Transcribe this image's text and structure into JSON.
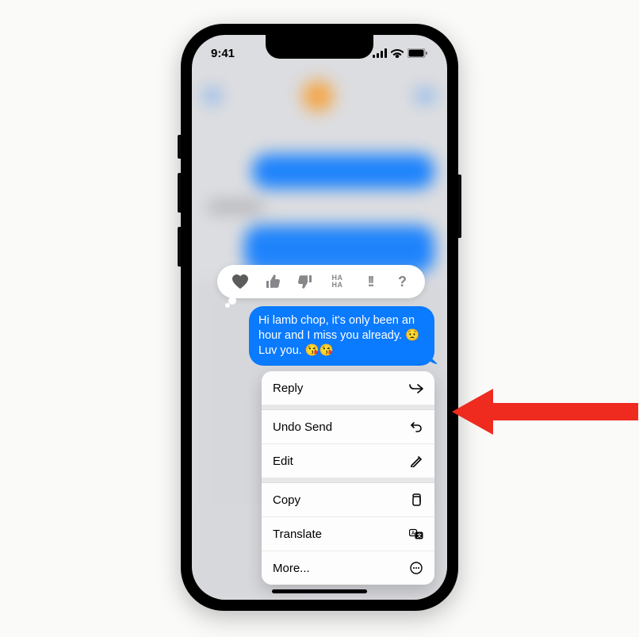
{
  "status": {
    "time": "9:41"
  },
  "message": {
    "text": "Hi lamb chop, it's only been an hour and I miss you already. 😟 Luv you. 😘😘"
  },
  "tapbacks": {
    "heart": "heart",
    "thumbs_up": "thumbs-up",
    "thumbs_down": "thumbs-down",
    "haha": "HA\nHA",
    "exclaim": "!!",
    "question": "?"
  },
  "context_menu": {
    "groups": [
      [
        {
          "label": "Reply",
          "icon": "reply-arrow-icon"
        }
      ],
      [
        {
          "label": "Undo Send",
          "icon": "undo-icon"
        },
        {
          "label": "Edit",
          "icon": "pencil-icon"
        }
      ],
      [
        {
          "label": "Copy",
          "icon": "copy-icon"
        },
        {
          "label": "Translate",
          "icon": "translate-icon"
        },
        {
          "label": "More...",
          "icon": "ellipsis-circle-icon"
        }
      ]
    ]
  },
  "annotation": {
    "arrow_color": "#ef2a1f",
    "arrow_target": "Undo Send"
  }
}
